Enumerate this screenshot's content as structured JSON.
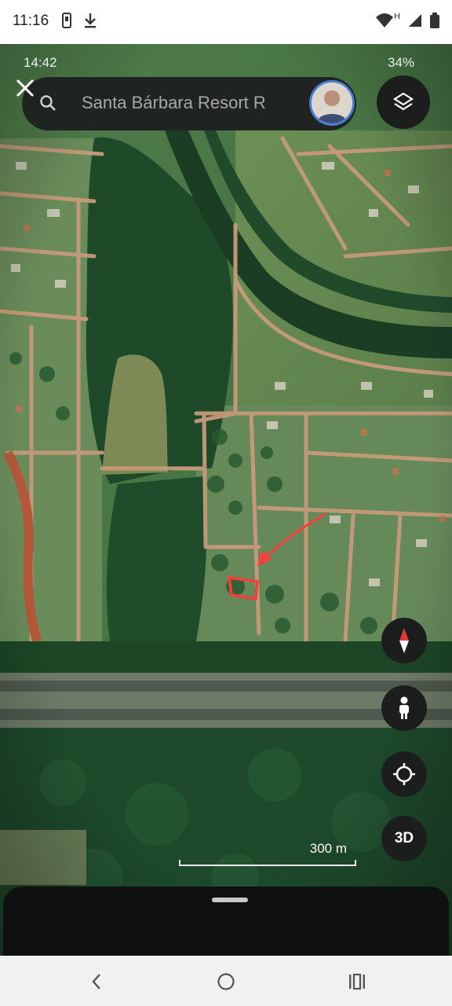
{
  "status_bar": {
    "time": "11:16",
    "icons_left": [
      "phone-icon",
      "download-icon"
    ],
    "icons_right": [
      "wifi-icon",
      "signal-icon",
      "battery-icon"
    ],
    "network_label": "H"
  },
  "screenshot": {
    "inner_time": "14:42",
    "inner_battery": "34%",
    "search": {
      "placeholder": "Santa Bárbara Resort R"
    },
    "scale_label": "300 m",
    "controls": {
      "three_d_label": "3D"
    },
    "colors": {
      "annotation_red": "#ff3b3b",
      "button_bg": "#1c1e1d",
      "compass_red": "#e53935"
    }
  },
  "nav": {
    "icons": [
      "back-icon",
      "home-icon",
      "recents-icon"
    ]
  }
}
